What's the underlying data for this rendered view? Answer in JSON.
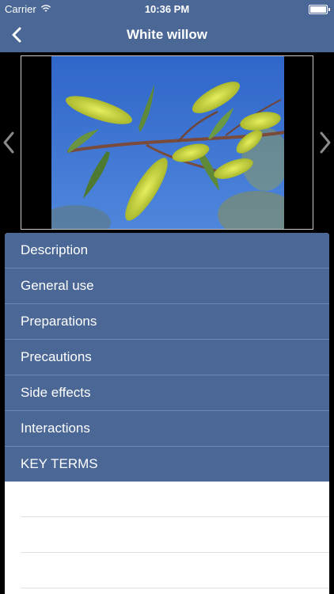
{
  "status_bar": {
    "carrier": "Carrier",
    "time": "10:36 PM"
  },
  "nav": {
    "title": "White willow"
  },
  "menu": {
    "items": [
      {
        "label": "Description"
      },
      {
        "label": "General use"
      },
      {
        "label": "Preparations"
      },
      {
        "label": "Precautions"
      },
      {
        "label": "Side effects"
      },
      {
        "label": "Interactions"
      },
      {
        "label": "KEY TERMS"
      }
    ]
  },
  "colors": {
    "nav_bg": "#4a6795",
    "row_bg": "#4a6795",
    "row_divider": "#6d86ae"
  }
}
